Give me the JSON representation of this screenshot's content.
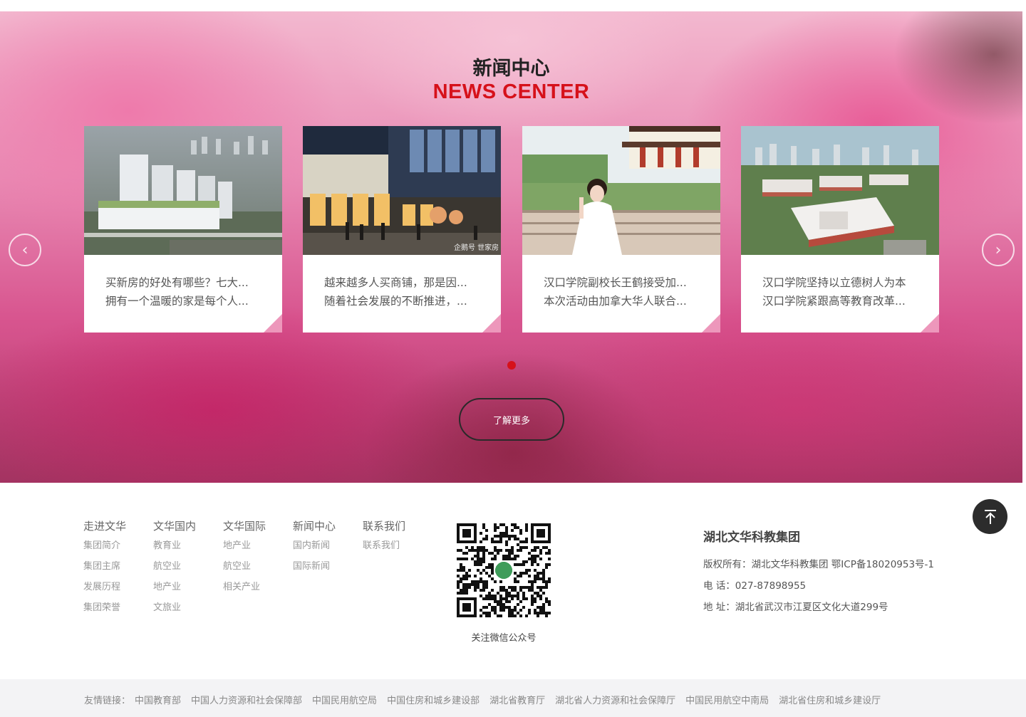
{
  "news": {
    "title": "新闻中心",
    "subtitle": "NEWS CENTER",
    "cards": [
      {
        "line1": "买新房的好处有哪些？七大...",
        "line2": "拥有一个温暖的家是每个人..."
      },
      {
        "line1": "越来越多人买商铺，那是因...",
        "line2": "随着社会发展的不断推进，..."
      },
      {
        "line1": "汉口学院副校长王鹤接受加...",
        "line2": "本次活动由加拿大华人联合..."
      },
      {
        "line1": "汉口学院坚持以立德树人为本",
        "line2": "汉口学院紧跟高等教育改革..."
      }
    ],
    "card2_watermark": "企鹅号 世家房",
    "more_label": "了解更多",
    "prev_icon": "chevron-left-icon",
    "next_icon": "chevron-right-icon"
  },
  "footer": {
    "columns": [
      {
        "head": "走进文华",
        "items": [
          "集团简介",
          "集团主席",
          "发展历程",
          "集团荣誉"
        ]
      },
      {
        "head": "文华国内",
        "items": [
          "教育业",
          "航空业",
          "地产业",
          "文旅业"
        ]
      },
      {
        "head": "文华国际",
        "items": [
          "地产业",
          "航空业",
          "相关产业"
        ]
      },
      {
        "head": "新闻中心",
        "items": [
          "国内新闻",
          "国际新闻"
        ]
      },
      {
        "head": "联系我们",
        "items": [
          "联系我们"
        ]
      }
    ],
    "qr_label": "关注微信公众号",
    "company": "湖北文华科教集团",
    "copyright": "版权所有：湖北文华科教集团 鄂ICP备18020953号-1",
    "phone": "电 话：027-87898955",
    "address": "地 址：湖北省武汉市江夏区文化大道299号",
    "back_top_icon": "arrow-up-to-top-icon"
  },
  "links": {
    "label": "友情链接：",
    "items": [
      "中国教育部",
      "中国人力资源和社会保障部",
      "中国民用航空局",
      "中国住房和城乡建设部",
      "湖北省教育厅",
      "湖北省人力资源和社会保障厅",
      "中国民用航空中南局",
      "湖北省住房和城乡建设厅"
    ]
  },
  "colors": {
    "accent_red": "#d6111a",
    "title_dark": "#222222",
    "footer_text": "#999999",
    "links_bg": "#f3f3f5"
  }
}
